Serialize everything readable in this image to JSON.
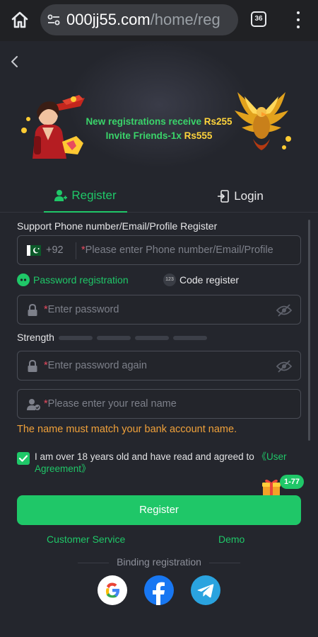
{
  "browser": {
    "url_host": "000jj55.com",
    "url_path": "/home/reg",
    "tab_count": "36"
  },
  "banner": {
    "line1_text": "New registrations receive ",
    "line1_amount": "Rs255",
    "line2_text": "Invite Friends-1x ",
    "line2_amount": "Rs555"
  },
  "tabs": {
    "register": "Register",
    "login": "Login"
  },
  "form": {
    "support_label": "Support Phone number/Email/Profile Register",
    "phone_code": "+92",
    "phone_placeholder": "Please enter Phone number/Email/Profile",
    "mode_password": "Password registration",
    "mode_code": "Code register",
    "password_placeholder": "Enter password",
    "strength_label": "Strength",
    "confirm_placeholder": "Enter password again",
    "name_placeholder": "Please enter your real name",
    "name_warning": "The name must match your bank account name.",
    "agree_text": "I am over 18 years old and have read and agreed to ",
    "agree_link": "《User Agreement》",
    "gift_badge": "1-77",
    "register_button": "Register"
  },
  "links": {
    "customer_service": "Customer Service",
    "demo": "Demo"
  },
  "binding": {
    "title": "Binding registration"
  },
  "colors": {
    "accent": "#1fc768",
    "warning": "#f0a13a",
    "required": "#e84a5f",
    "amount": "#ffd43b"
  }
}
